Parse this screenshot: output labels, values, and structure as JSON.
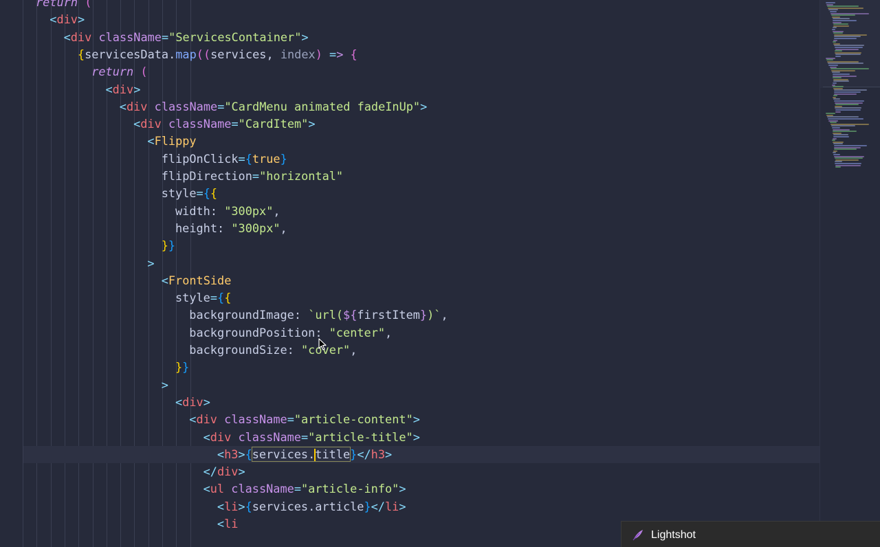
{
  "editor": {
    "language": "JSX",
    "cursor": {
      "line": 28
    },
    "lines": [
      "return (",
      "<div>",
      "<div className=\"ServicesContainer\">",
      "{servicesData.map((services, index) => {",
      "return (",
      "<div>",
      "<div className=\"CardMenu animated fadeInUp\">",
      "<div className=\"CardItem\">",
      "<Flippy",
      "flipOnClick={true}",
      "flipDirection=\"horizontal\"",
      "style={{",
      "width: \"300px\",",
      "height: \"300px\",",
      "}}",
      ">",
      "<FrontSide",
      "style={{",
      "backgroundImage: `url(${firstItem})`,",
      "backgroundPosition: \"center\",",
      "backgroundSize: \"cover\",",
      "}}",
      ">",
      "<div>",
      "<div className=\"article-content\">",
      "<div className=\"article-title\">",
      "<h3>{services.title}</h3>",
      "</div>",
      "<ul className=\"article-info\">",
      "<li>{services.article}</li>",
      "<li"
    ]
  },
  "colors": {
    "background": "#262a3a",
    "keyword": "#c792ea",
    "tag": "#f07178",
    "string": "#c3e88d",
    "component": "#ffcb6b",
    "function": "#82aaff",
    "punctuation": "#89ddff"
  },
  "notification": {
    "app_name": "Lightshot",
    "icon": "lightshot-feather-icon"
  },
  "overlay": {
    "mouse_icon": "arrow-cursor-icon"
  }
}
